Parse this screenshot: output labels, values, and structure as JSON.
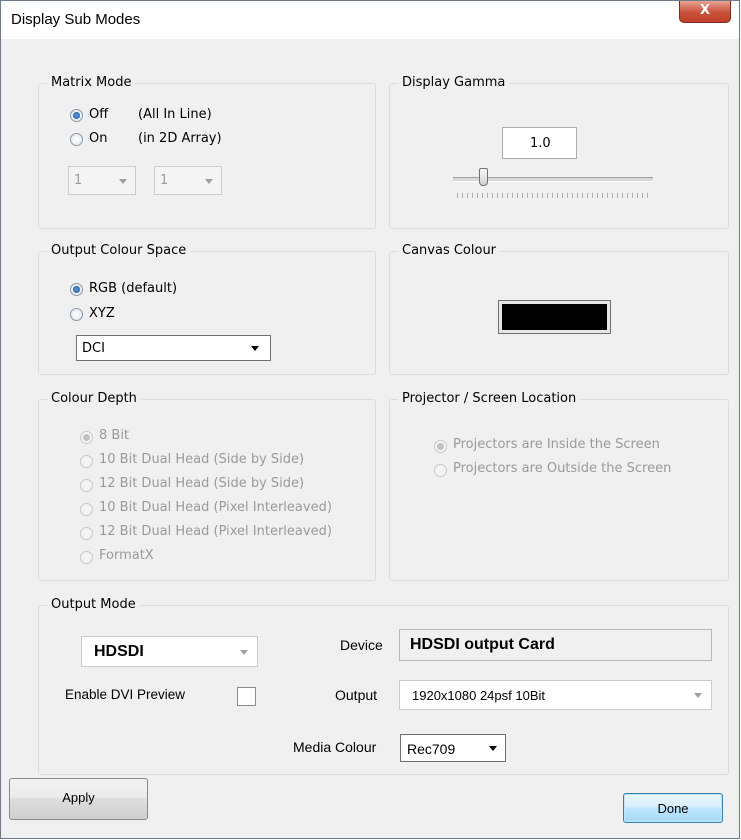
{
  "window": {
    "title": "Display Sub Modes",
    "close_label": "X"
  },
  "matrix_mode": {
    "title": "Matrix Mode",
    "off_label": "Off",
    "off_note": "(All In Line)",
    "on_label": "On",
    "on_note": "(in 2D Array)",
    "selected": "off",
    "cols_value": "1",
    "rows_value": "1"
  },
  "display_gamma": {
    "title": "Display Gamma",
    "value": "1.0",
    "slider_level": 0.18
  },
  "output_colour_space": {
    "title": "Output Colour Space",
    "rgb_label": "RGB (default)",
    "xyz_label": "XYZ",
    "selected": "rgb",
    "xyz_option": "DCI"
  },
  "canvas_colour": {
    "title": "Canvas Colour",
    "swatch_color": "#000000"
  },
  "colour_depth": {
    "title": "Colour Depth",
    "options": [
      "8 Bit",
      "10 Bit Dual Head (Side by Side)",
      "12 Bit Dual Head (Side by Side)",
      "10 Bit Dual Head (Pixel Interleaved)",
      "12 Bit Dual Head (Pixel Interleaved)",
      "FormatX"
    ],
    "selected_index": 0
  },
  "projector_location": {
    "title": "Projector / Screen Location",
    "inside_label": "Projectors are Inside the Screen",
    "outside_label": "Projectors are Outside the Screen",
    "selected": "inside"
  },
  "output_mode": {
    "title": "Output Mode",
    "mode_value": "HDSDI",
    "dvi_preview_label": "Enable DVI Preview",
    "dvi_preview_checked": false,
    "device_label": "Device",
    "device_value": "HDSDI output Card",
    "output_label": "Output",
    "output_value": "1920x1080 24psf 10Bit",
    "media_colour_label": "Media Colour",
    "media_colour_value": "Rec709"
  },
  "buttons": {
    "apply": "Apply",
    "done": "Done"
  }
}
